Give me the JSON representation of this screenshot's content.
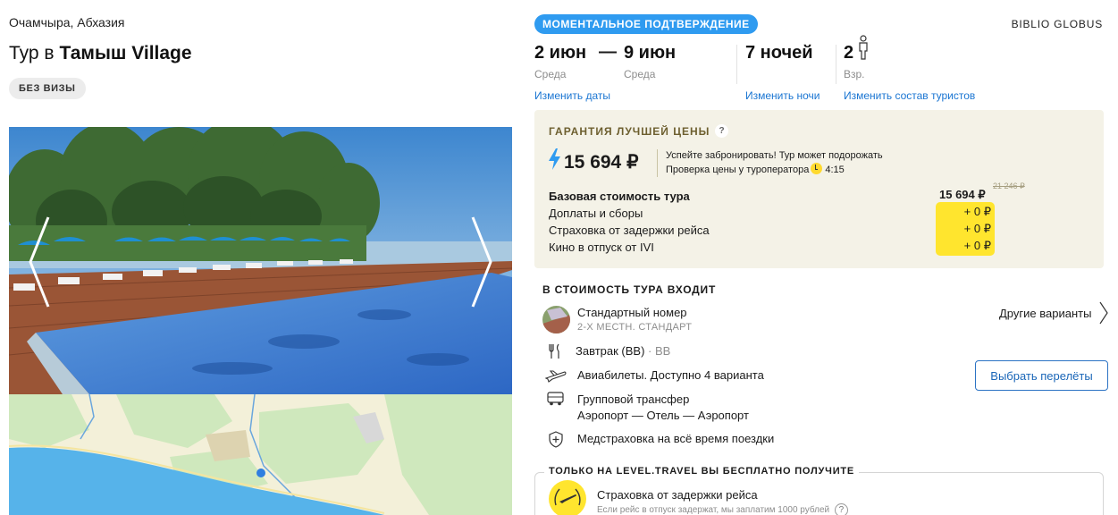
{
  "location": "Очамчыра, Абхазия",
  "title": {
    "prefix": "Тур в",
    "hotel": "Тамыш Village"
  },
  "visa_badge": "БЕЗ ВИЗЫ",
  "instant_badge": "МОМЕНТАЛЬНОЕ ПОДТВЕРЖДЕНИЕ",
  "operator": "BIBLIO GLOBUS",
  "dates": {
    "from": {
      "date": "2 июн",
      "weekday": "Среда"
    },
    "dash": "—",
    "to": {
      "date": "9 июн",
      "weekday": "Среда"
    },
    "change_link": "Изменить даты"
  },
  "nights": {
    "value": "7 ночей",
    "change_link": "Изменить ночи"
  },
  "tourists": {
    "count": "2",
    "type": "Взр.",
    "change_link": "Изменить состав туристов",
    "icon": "person-icon"
  },
  "price": {
    "guarantee_label": "ГАРАНТИЯ ЛУЧШЕЙ ЦЕНЫ",
    "help": "?",
    "main": "15 694 ₽",
    "hurry_line1": "Успейте забронировать! Тур может подорожать",
    "hurry_line2": "Проверка цены у туроператора",
    "timer": "4:15",
    "rows": [
      {
        "label": "Базовая стоимость тура",
        "value": "15 694 ₽",
        "old": "21 246 ₽"
      },
      {
        "label": "Доплаты и сборы",
        "value": "+ 0 ₽"
      },
      {
        "label": "Страховка от задержки рейса",
        "value": "+ 0 ₽"
      },
      {
        "label": "Кино в отпуск от IVI",
        "value": "+ 0 ₽"
      }
    ],
    "colors": {
      "box_bg": "#f4f2e7",
      "highlight": "#ffe52e"
    }
  },
  "includes": {
    "title": "В СТОИМОСТЬ ТУРА ВХОДИТ",
    "room": {
      "label": "Стандартный номер",
      "sub": "2-Х МЕСТН. СТАНДАРТ",
      "other_link": "Другие варианты"
    },
    "meal": {
      "label": "Завтрак (BB)",
      "extra": "· BB"
    },
    "flights": {
      "label": "Авиабилеты. Доступно 4 варианта",
      "button": "Выбрать перелёты"
    },
    "transfer": {
      "label": "Групповой трансфер",
      "sub": "Аэропорт — Отель — Аэропорт"
    },
    "insurance": {
      "label": "Медстраховка на всё время поездки"
    }
  },
  "bonus": {
    "title": "ТОЛЬКО НА LEVEL.TRAVEL ВЫ БЕСПЛАТНО ПОЛУЧИТЕ",
    "label": "Страховка от задержки рейса",
    "sub": "Если рейс в отпуск задержат, мы заплатим 1000 рублей",
    "help": "?"
  },
  "accent_color": "#2f9bf0",
  "link_color": "#1a75d2"
}
